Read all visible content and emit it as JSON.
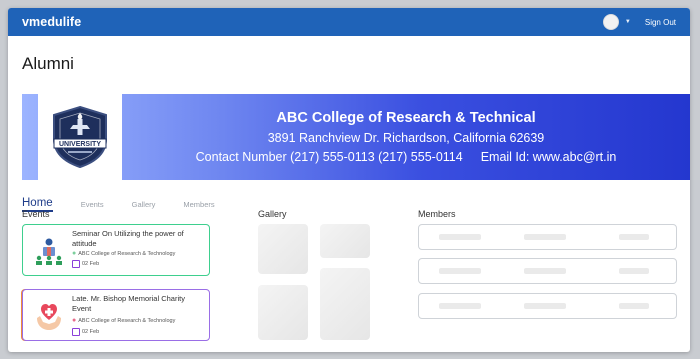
{
  "app": {
    "brand": "vmedulife",
    "sign_out": "Sign Out"
  },
  "page": {
    "title": "Alumni"
  },
  "banner": {
    "college": "ABC College of Research & Technical",
    "address": "3891 Ranchview Dr. Richardson, California 62639",
    "contact": "Contact Number (217) 555-0113 (217) 555-0114",
    "email": "Email Id: www.abc@rt.in",
    "logo_text": "UNIVERSITY"
  },
  "tabs": [
    "Home",
    "Events",
    "Gallery",
    "Members"
  ],
  "sections": {
    "events": "Events",
    "gallery": "Gallery",
    "members": "Members"
  },
  "events": [
    {
      "title": "Seminar On Utilizing the power of attitude",
      "org": "ABC College of Research & Technology",
      "date": "02 Feb",
      "border": "#3ecf8e"
    },
    {
      "title": "Late. Mr. Bishop Memorial Charity Event",
      "org": "ABC College of Research & Technology",
      "date": "02 Feb",
      "border": "#9a6ee6"
    }
  ],
  "colors": {
    "topbar": "#1f63b8",
    "accent": "#1f3d8a"
  }
}
